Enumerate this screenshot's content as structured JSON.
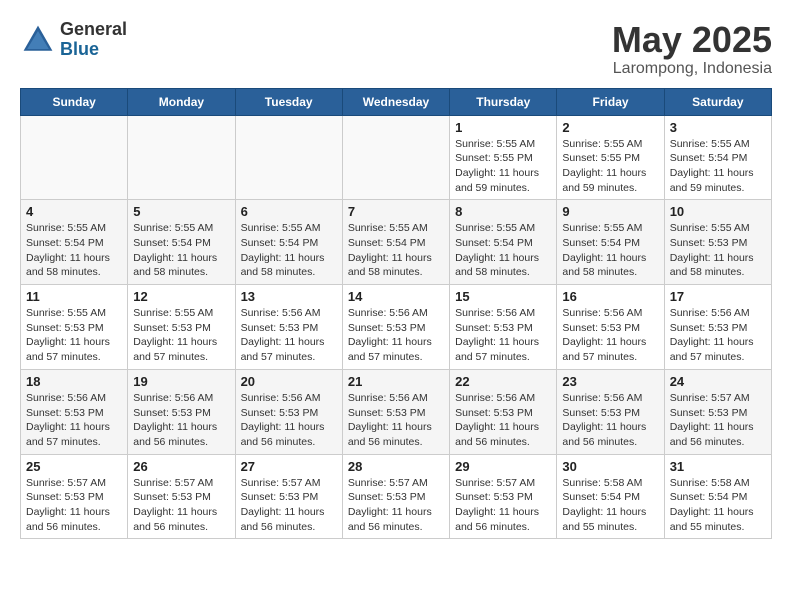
{
  "header": {
    "logo_general": "General",
    "logo_blue": "Blue",
    "month_title": "May 2025",
    "location": "Larompong, Indonesia"
  },
  "weekdays": [
    "Sunday",
    "Monday",
    "Tuesday",
    "Wednesday",
    "Thursday",
    "Friday",
    "Saturday"
  ],
  "weeks": [
    [
      {
        "day": "",
        "info": ""
      },
      {
        "day": "",
        "info": ""
      },
      {
        "day": "",
        "info": ""
      },
      {
        "day": "",
        "info": ""
      },
      {
        "day": "1",
        "info": "Sunrise: 5:55 AM\nSunset: 5:55 PM\nDaylight: 11 hours\nand 59 minutes."
      },
      {
        "day": "2",
        "info": "Sunrise: 5:55 AM\nSunset: 5:55 PM\nDaylight: 11 hours\nand 59 minutes."
      },
      {
        "day": "3",
        "info": "Sunrise: 5:55 AM\nSunset: 5:54 PM\nDaylight: 11 hours\nand 59 minutes."
      }
    ],
    [
      {
        "day": "4",
        "info": "Sunrise: 5:55 AM\nSunset: 5:54 PM\nDaylight: 11 hours\nand 58 minutes."
      },
      {
        "day": "5",
        "info": "Sunrise: 5:55 AM\nSunset: 5:54 PM\nDaylight: 11 hours\nand 58 minutes."
      },
      {
        "day": "6",
        "info": "Sunrise: 5:55 AM\nSunset: 5:54 PM\nDaylight: 11 hours\nand 58 minutes."
      },
      {
        "day": "7",
        "info": "Sunrise: 5:55 AM\nSunset: 5:54 PM\nDaylight: 11 hours\nand 58 minutes."
      },
      {
        "day": "8",
        "info": "Sunrise: 5:55 AM\nSunset: 5:54 PM\nDaylight: 11 hours\nand 58 minutes."
      },
      {
        "day": "9",
        "info": "Sunrise: 5:55 AM\nSunset: 5:54 PM\nDaylight: 11 hours\nand 58 minutes."
      },
      {
        "day": "10",
        "info": "Sunrise: 5:55 AM\nSunset: 5:53 PM\nDaylight: 11 hours\nand 58 minutes."
      }
    ],
    [
      {
        "day": "11",
        "info": "Sunrise: 5:55 AM\nSunset: 5:53 PM\nDaylight: 11 hours\nand 57 minutes."
      },
      {
        "day": "12",
        "info": "Sunrise: 5:55 AM\nSunset: 5:53 PM\nDaylight: 11 hours\nand 57 minutes."
      },
      {
        "day": "13",
        "info": "Sunrise: 5:56 AM\nSunset: 5:53 PM\nDaylight: 11 hours\nand 57 minutes."
      },
      {
        "day": "14",
        "info": "Sunrise: 5:56 AM\nSunset: 5:53 PM\nDaylight: 11 hours\nand 57 minutes."
      },
      {
        "day": "15",
        "info": "Sunrise: 5:56 AM\nSunset: 5:53 PM\nDaylight: 11 hours\nand 57 minutes."
      },
      {
        "day": "16",
        "info": "Sunrise: 5:56 AM\nSunset: 5:53 PM\nDaylight: 11 hours\nand 57 minutes."
      },
      {
        "day": "17",
        "info": "Sunrise: 5:56 AM\nSunset: 5:53 PM\nDaylight: 11 hours\nand 57 minutes."
      }
    ],
    [
      {
        "day": "18",
        "info": "Sunrise: 5:56 AM\nSunset: 5:53 PM\nDaylight: 11 hours\nand 57 minutes."
      },
      {
        "day": "19",
        "info": "Sunrise: 5:56 AM\nSunset: 5:53 PM\nDaylight: 11 hours\nand 56 minutes."
      },
      {
        "day": "20",
        "info": "Sunrise: 5:56 AM\nSunset: 5:53 PM\nDaylight: 11 hours\nand 56 minutes."
      },
      {
        "day": "21",
        "info": "Sunrise: 5:56 AM\nSunset: 5:53 PM\nDaylight: 11 hours\nand 56 minutes."
      },
      {
        "day": "22",
        "info": "Sunrise: 5:56 AM\nSunset: 5:53 PM\nDaylight: 11 hours\nand 56 minutes."
      },
      {
        "day": "23",
        "info": "Sunrise: 5:56 AM\nSunset: 5:53 PM\nDaylight: 11 hours\nand 56 minutes."
      },
      {
        "day": "24",
        "info": "Sunrise: 5:57 AM\nSunset: 5:53 PM\nDaylight: 11 hours\nand 56 minutes."
      }
    ],
    [
      {
        "day": "25",
        "info": "Sunrise: 5:57 AM\nSunset: 5:53 PM\nDaylight: 11 hours\nand 56 minutes."
      },
      {
        "day": "26",
        "info": "Sunrise: 5:57 AM\nSunset: 5:53 PM\nDaylight: 11 hours\nand 56 minutes."
      },
      {
        "day": "27",
        "info": "Sunrise: 5:57 AM\nSunset: 5:53 PM\nDaylight: 11 hours\nand 56 minutes."
      },
      {
        "day": "28",
        "info": "Sunrise: 5:57 AM\nSunset: 5:53 PM\nDaylight: 11 hours\nand 56 minutes."
      },
      {
        "day": "29",
        "info": "Sunrise: 5:57 AM\nSunset: 5:53 PM\nDaylight: 11 hours\nand 56 minutes."
      },
      {
        "day": "30",
        "info": "Sunrise: 5:58 AM\nSunset: 5:54 PM\nDaylight: 11 hours\nand 55 minutes."
      },
      {
        "day": "31",
        "info": "Sunrise: 5:58 AM\nSunset: 5:54 PM\nDaylight: 11 hours\nand 55 minutes."
      }
    ]
  ]
}
